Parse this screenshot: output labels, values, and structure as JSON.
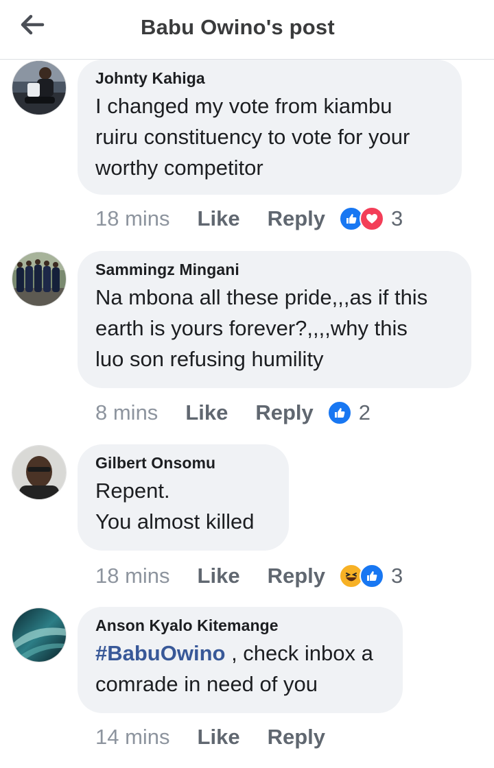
{
  "header": {
    "title": "Babu Owino's post",
    "back_icon": "arrow-left-icon"
  },
  "comments": [
    {
      "author": "Johnty Kahiga",
      "text": "I changed my vote from kiambu\nruiru constituency to vote for your\nworthy competitor",
      "time": "18 mins",
      "like": "Like",
      "reply": "Reply",
      "reactions": [
        "like-icon",
        "love-icon"
      ],
      "reaction_count": "3"
    },
    {
      "author": "Sammingz Mingani",
      "text": "Na mbona all these pride,,,as if this\nearth is yours forever?,,,,why this\nluo son refusing humility",
      "time": "8 mins",
      "like": "Like",
      "reply": "Reply",
      "reactions": [
        "like-icon"
      ],
      "reaction_count": "2"
    },
    {
      "author": "Gilbert Onsomu",
      "text": "Repent.\nYou almost killed",
      "time": "18 mins",
      "like": "Like",
      "reply": "Reply",
      "reactions": [
        "haha-icon",
        "like-icon"
      ],
      "reaction_count": "3"
    },
    {
      "author": "Anson Kyalo Kitemange",
      "hashtag": "#BabuOwino",
      "text": " , check inbox a\ncomrade in need of you",
      "time": "14 mins",
      "like": "Like",
      "reply": "Reply"
    }
  ],
  "colors": {
    "like_blue": "#1877f2",
    "love_red": "#f33e58",
    "haha_yellow": "#f7b125",
    "hashtag": "#385898",
    "bubble_bg": "#f0f2f5"
  }
}
